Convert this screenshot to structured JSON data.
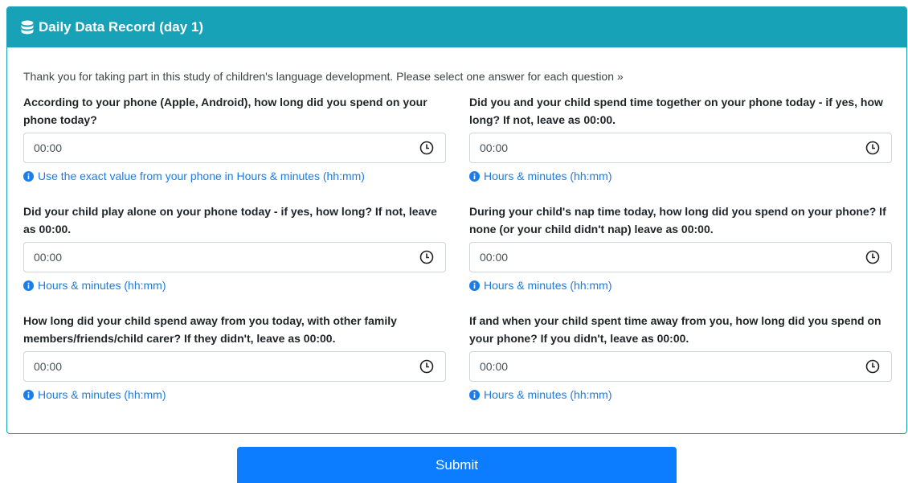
{
  "header": {
    "title": "Daily Data Record (day 1)",
    "icon": "database-icon"
  },
  "intro": "Thank you for taking part in this study of children's language development. Please select one answer for each question »",
  "questions": [
    {
      "label": "According to your phone (Apple, Android), how long did you spend on your phone today?",
      "value": "00:00",
      "help": "Use the exact value from your phone in Hours & minutes (hh:mm)"
    },
    {
      "label": "Did you and your child spend time together on your phone today - if yes, how long? If not, leave as 00:00.",
      "value": "00:00",
      "help": "Hours & minutes (hh:mm)"
    },
    {
      "label": "Did your child play alone on your phone today - if yes, how long? If not, leave as 00:00.",
      "value": "00:00",
      "help": "Hours & minutes (hh:mm)"
    },
    {
      "label": "During your child's nap time today, how long did you spend on your phone? If none (or your child didn't nap) leave as 00:00.",
      "value": "00:00",
      "help": "Hours & minutes (hh:mm)"
    },
    {
      "label": "How long did your child spend away from you today, with other family members/friends/child carer? If they didn't, leave as 00:00.",
      "value": "00:00",
      "help": "Hours & minutes (hh:mm)"
    },
    {
      "label": "If and when your child spent time away from you, how long did you spend on your phone? If you didn't, leave as 00:00.",
      "value": "00:00",
      "help": "Hours & minutes (hh:mm)"
    }
  ],
  "submit_label": "Submit",
  "colors": {
    "header": "#17a2b8",
    "button": "#0d7dff",
    "help_text": "#1c7ce8"
  }
}
